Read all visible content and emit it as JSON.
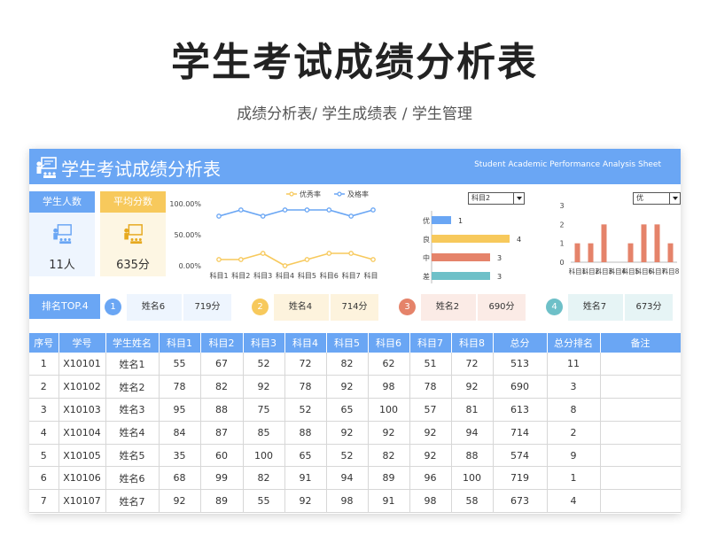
{
  "header": {
    "title": "学生考试成绩分析表",
    "subtitle": "成绩分析表/ 学生成绩表 / 学生管理"
  },
  "sheet": {
    "banner_title": "学生考试成绩分析表",
    "banner_en": "Student Academic Performance Analysis Sheet"
  },
  "cards": {
    "students_label": "学生人数",
    "students_value": "11人",
    "avg_label": "平均分数",
    "avg_value": "635分"
  },
  "selects": {
    "subject": "科目2",
    "grade": "优"
  },
  "colors": {
    "blue": "#6aa6f4",
    "yellow": "#f7c95c",
    "red": "#e5836a",
    "teal": "#6ec0c8"
  },
  "ranking": {
    "label": "排名TOP.4",
    "items": [
      {
        "rank": "1",
        "name": "姓名6",
        "score": "719分"
      },
      {
        "rank": "2",
        "name": "姓名4",
        "score": "714分"
      },
      {
        "rank": "3",
        "name": "姓名2",
        "score": "690分"
      },
      {
        "rank": "4",
        "name": "姓名7",
        "score": "673分"
      }
    ]
  },
  "table": {
    "columns": [
      "序号",
      "学号",
      "学生姓名",
      "科目1",
      "科目2",
      "科目3",
      "科目4",
      "科目5",
      "科目6",
      "科目7",
      "科目8",
      "总分",
      "总分排名",
      "备注"
    ],
    "rows": [
      [
        "1",
        "X10101",
        "姓名1",
        "55",
        "67",
        "52",
        "72",
        "82",
        "62",
        "51",
        "72",
        "513",
        "11",
        ""
      ],
      [
        "2",
        "X10102",
        "姓名2",
        "78",
        "82",
        "92",
        "78",
        "92",
        "98",
        "78",
        "92",
        "690",
        "3",
        ""
      ],
      [
        "3",
        "X10103",
        "姓名3",
        "95",
        "88",
        "75",
        "52",
        "65",
        "100",
        "57",
        "81",
        "613",
        "8",
        ""
      ],
      [
        "4",
        "X10104",
        "姓名4",
        "84",
        "87",
        "85",
        "88",
        "92",
        "92",
        "92",
        "94",
        "714",
        "2",
        ""
      ],
      [
        "5",
        "X10105",
        "姓名5",
        "35",
        "60",
        "100",
        "65",
        "52",
        "82",
        "92",
        "88",
        "574",
        "9",
        ""
      ],
      [
        "6",
        "X10106",
        "姓名6",
        "68",
        "99",
        "82",
        "91",
        "94",
        "89",
        "96",
        "100",
        "719",
        "1",
        ""
      ],
      [
        "7",
        "X10107",
        "姓名7",
        "92",
        "89",
        "55",
        "92",
        "98",
        "91",
        "98",
        "58",
        "673",
        "4",
        ""
      ]
    ]
  },
  "chart_data": [
    {
      "type": "line",
      "x": [
        "科目1",
        "科目2",
        "科目3",
        "科目4",
        "科目5",
        "科目6",
        "科目7",
        "科目8"
      ],
      "yticks": [
        "100.00%",
        "50.00%",
        "0.00%"
      ],
      "ylim": [
        0,
        1
      ],
      "legend": "top",
      "series": [
        {
          "name": "优秀率",
          "color": "#f7c95c",
          "values": [
            0.1,
            0.1,
            0.2,
            0.0,
            0.1,
            0.2,
            0.2,
            0.1
          ]
        },
        {
          "name": "及格率",
          "color": "#6aa6f4",
          "values": [
            0.8,
            0.9,
            0.8,
            0.9,
            0.9,
            0.9,
            0.8,
            0.9
          ]
        }
      ]
    },
    {
      "type": "bar",
      "orientation": "horizontal",
      "categories": [
        "优",
        "良",
        "中",
        "差"
      ],
      "values": [
        1,
        4,
        3,
        3
      ],
      "colors": [
        "#6aa6f4",
        "#f7c95c",
        "#e5836a",
        "#6ec0c8"
      ],
      "xlim": [
        0,
        4
      ]
    },
    {
      "type": "bar",
      "categories": [
        "科目1",
        "科目2",
        "科目3",
        "科目4",
        "科目5",
        "科目6",
        "科目7",
        "科目8"
      ],
      "values": [
        1,
        1,
        2,
        0,
        1,
        2,
        2,
        1
      ],
      "yticks": [
        "3",
        "2",
        "1",
        "0"
      ],
      "ylim": [
        0,
        3
      ],
      "color": "#e5836a"
    }
  ]
}
